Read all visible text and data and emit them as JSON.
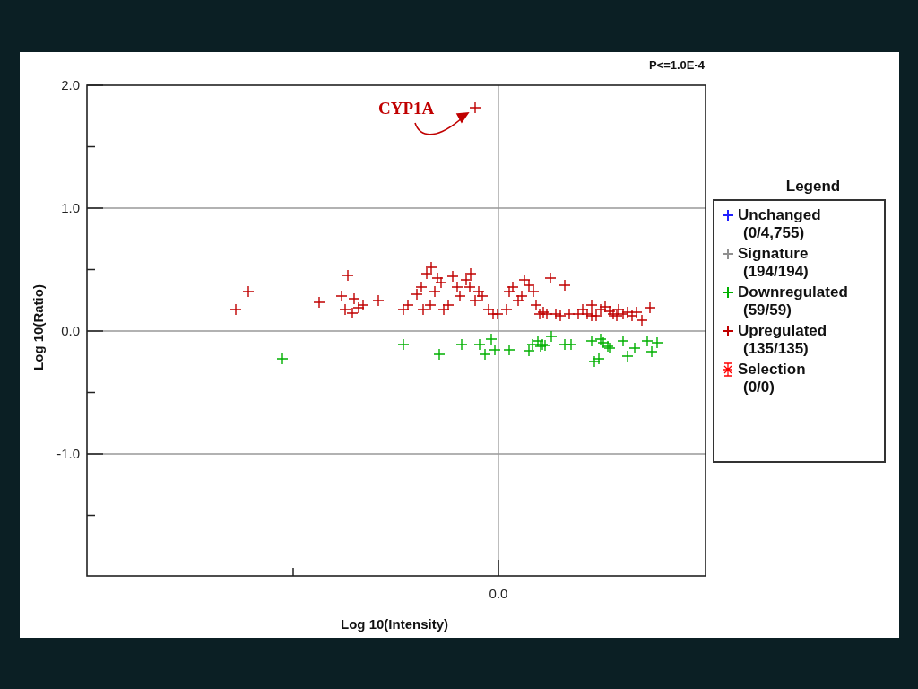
{
  "chart": {
    "title": "P<=1.0E-4",
    "ylabel": "Log 10(Ratio)",
    "xlabel": "Log 10(Intensity)",
    "annotation": "CYP1A",
    "y_tick_labels": [
      "2.0",
      "1.0",
      "0.0",
      "-1.0"
    ],
    "x_tick_labels": [
      "0.0"
    ]
  },
  "legend": {
    "title": "Legend",
    "items": [
      {
        "label": "Unchanged",
        "count": "(0/4,755)",
        "color": "#2020ff",
        "kind": "plus"
      },
      {
        "label": "Signature",
        "count": "(194/194)",
        "color": "#909090",
        "kind": "plus"
      },
      {
        "label": "Downregulated",
        "count": "(59/59)",
        "color": "#00b000",
        "kind": "plus"
      },
      {
        "label": "Upregulated",
        "count": "(135/135)",
        "color": "#c00000",
        "kind": "plus"
      },
      {
        "label": "Selection",
        "count": "(0/0)",
        "color": "#ff0000",
        "kind": "asterisk"
      }
    ]
  }
}
